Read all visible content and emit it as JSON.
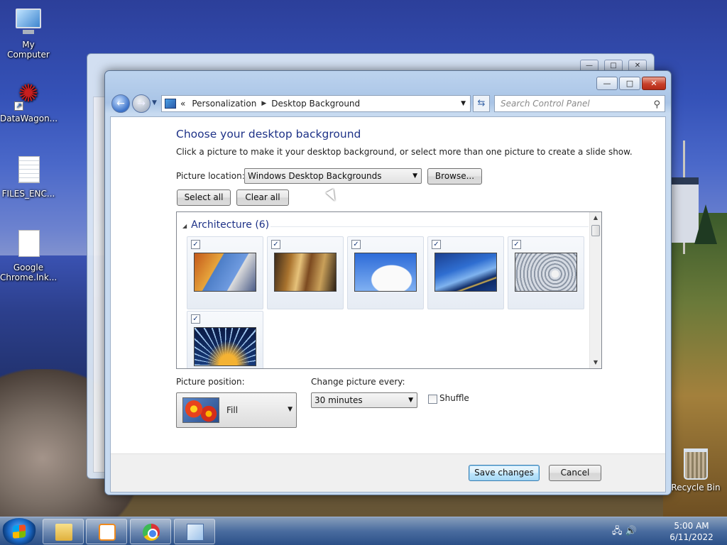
{
  "desktop": {
    "icons": [
      {
        "label": "My Computer"
      },
      {
        "label": "DataWagon..."
      },
      {
        "label": "FILES_ENC..."
      },
      {
        "label": "Google Chrome.lnk..."
      }
    ],
    "recycle_bin": "Recycle Bin"
  },
  "window": {
    "breadcrumb": {
      "chevrons": "«",
      "level1": "Personalization",
      "level2": "Desktop Background"
    },
    "search_placeholder": "Search Control Panel",
    "controls": {
      "minimize": "—",
      "maximize": "□",
      "close": "✕"
    }
  },
  "page": {
    "heading": "Choose your desktop background",
    "subtext": "Click a picture to make it your desktop background, or select more than one picture to create a slide show.",
    "picture_location_label": "Picture location:",
    "picture_location_value": "Windows Desktop Backgrounds",
    "browse_button": "Browse...",
    "select_all_button": "Select all",
    "clear_all_button": "Clear all",
    "group": {
      "title": "Architecture (6)",
      "thumbnails": [
        {
          "checked": true,
          "name": "architecture-1"
        },
        {
          "checked": true,
          "name": "architecture-2"
        },
        {
          "checked": true,
          "name": "architecture-3"
        },
        {
          "checked": true,
          "name": "architecture-4"
        },
        {
          "checked": true,
          "name": "architecture-5"
        },
        {
          "checked": true,
          "name": "architecture-6"
        }
      ]
    },
    "picture_position_label": "Picture position:",
    "picture_position_value": "Fill",
    "change_picture_label": "Change picture every:",
    "change_picture_value": "30 minutes",
    "shuffle_label": "Shuffle",
    "shuffle_checked": false,
    "save_button": "Save changes",
    "cancel_button": "Cancel"
  },
  "taskbar": {
    "clock_time": "5:00 AM",
    "clock_date": "6/11/2022"
  }
}
